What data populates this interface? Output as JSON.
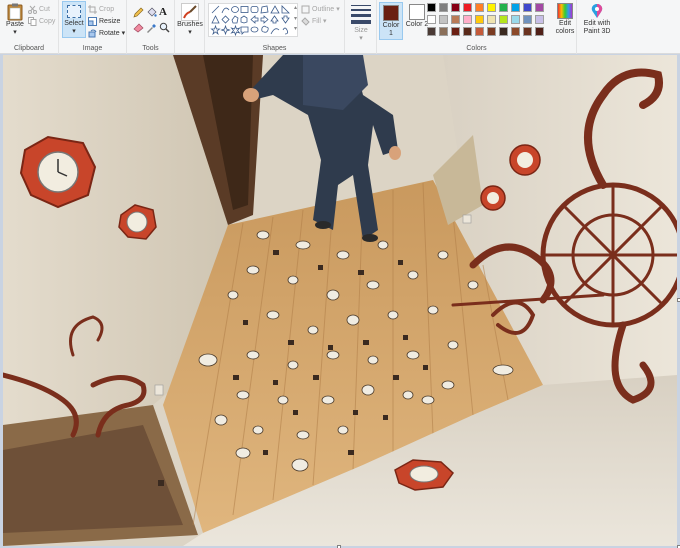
{
  "ribbon": {
    "clipboard": {
      "label": "Clipboard",
      "paste": "Paste",
      "cut": "Cut",
      "copy": "Copy"
    },
    "image": {
      "label": "Image",
      "select": "Select",
      "crop": "Crop",
      "resize": "Resize",
      "rotate": "Rotate"
    },
    "tools": {
      "label": "Tools"
    },
    "brushes": {
      "label": "Brushes"
    },
    "shapes": {
      "label": "Shapes",
      "outline": "Outline",
      "fill": "Fill"
    },
    "size": {
      "label": "Size"
    },
    "colors": {
      "label": "Colors",
      "color1": "Color 1",
      "color2": "Color 2",
      "edit_colors": "Edit colors",
      "color1_value": "#6a1f12",
      "color2_value": "#ffffff",
      "palette_row1": [
        "#000000",
        "#7f7f7f",
        "#880015",
        "#ed1c24",
        "#ff7f27",
        "#fff200",
        "#22b14c",
        "#00a2e8",
        "#3f48cc",
        "#a349a4"
      ],
      "palette_row2": [
        "#ffffff",
        "#c3c3c3",
        "#b97a57",
        "#ffaec9",
        "#ffc90e",
        "#efe4b0",
        "#b5e61d",
        "#99d9ea",
        "#7092be",
        "#c8bfe7"
      ],
      "palette_row3": [
        "#4a3a35",
        "#8a6f5a",
        "#6a1f12",
        "#5a2a1a",
        "#c45a3a",
        "#7a3b22",
        "#3b2a20",
        "#8c4a2a",
        "#6b3320",
        "#502018"
      ]
    },
    "paint3d": {
      "label": "Edit with Paint 3D"
    }
  },
  "canvas": {
    "image_subject": "painting-surreal-room-clocks"
  }
}
